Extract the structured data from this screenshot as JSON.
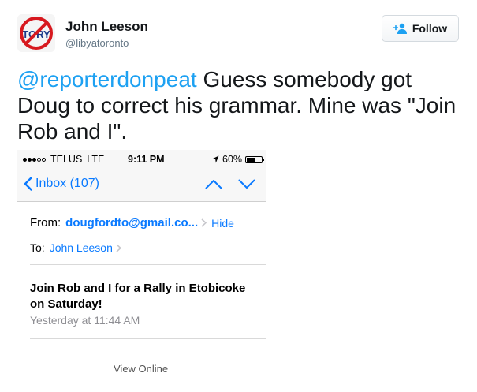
{
  "tweet": {
    "author": {
      "name": "John Leeson",
      "handle": "@libyatoronto",
      "avatar_text": "TORY"
    },
    "follow_label": "Follow",
    "text": {
      "mention": "@reporterdonpeat",
      "body": " Guess somebody got Doug to correct his grammar. Mine was \"Join Rob and I\"."
    }
  },
  "screenshot": {
    "status_bar": {
      "carrier": "TELUS",
      "network": "LTE",
      "time": "9:11 PM",
      "battery": "60%",
      "battery_level": 0.6,
      "signal_bars_filled": 3,
      "signal_bars_total": 5
    },
    "nav": {
      "back_label": "Inbox (107)"
    },
    "email": {
      "from_label": "From:",
      "from_address": "dougfordto@gmail.co...",
      "hide_label": "Hide",
      "to_label": "To:",
      "to_name": "John Leeson",
      "subject": "Join Rob and I for a Rally in Etobicoke on Saturday!",
      "date": "Yesterday at 11:44 AM"
    },
    "footer_link": "View Online"
  },
  "colors": {
    "link_blue": "#1da1f2",
    "ios_blue": "#0a7aff",
    "logo_red": "#d7191f",
    "logo_blue": "#1a3a8a"
  }
}
